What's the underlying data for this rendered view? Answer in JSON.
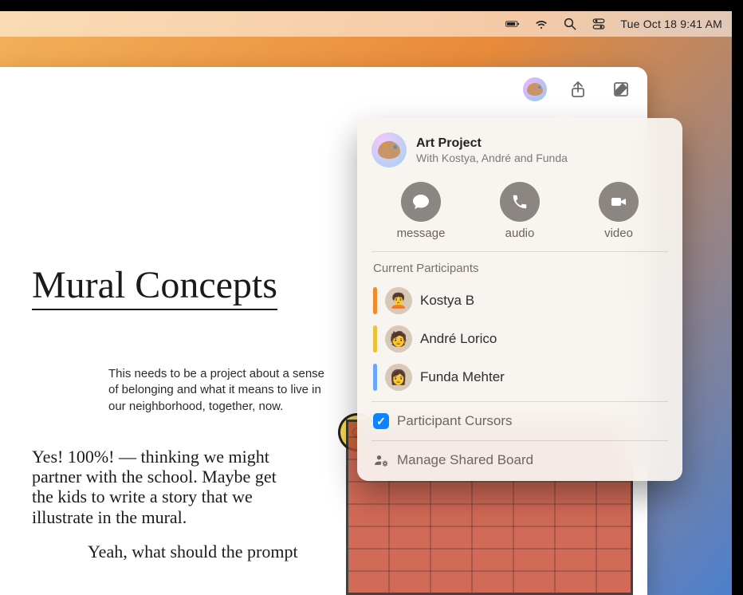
{
  "menubar": {
    "datetime": "Tue Oct 18  9:41 AM",
    "icons": [
      "battery-icon",
      "wifi-icon",
      "search-icon",
      "control-center-icon"
    ]
  },
  "toolbar": {
    "collaborate_icon": "palette-icon",
    "share_icon": "share-icon",
    "compose_icon": "compose-icon"
  },
  "canvas": {
    "title": "Mural Concepts",
    "body": "This needs to be a project about a sense of belonging and what it means to live in our neighborhood, together, now.",
    "hand_note1": "Yes! 100%! — thinking we might partner with the school. Maybe get the kids to write a story that we illustrate in the mural.",
    "hand_note2": "Yeah, what should the prompt"
  },
  "popover": {
    "title": "Art Project",
    "subtitle": "With Kostya, André and Funda",
    "comm": {
      "message": "message",
      "audio": "audio",
      "video": "video"
    },
    "participants_label": "Current Participants",
    "participants": [
      {
        "name": "Kostya B",
        "color": "#f08a2c",
        "emoji": "🧑‍🦱"
      },
      {
        "name": "André Lorico",
        "color": "#e8c23a",
        "emoji": "🧑"
      },
      {
        "name": "Funda Mehter",
        "color": "#6aa6ff",
        "emoji": "👩"
      }
    ],
    "cursors_label": "Participant Cursors",
    "cursors_checked": true,
    "manage_label": "Manage Shared Board"
  }
}
